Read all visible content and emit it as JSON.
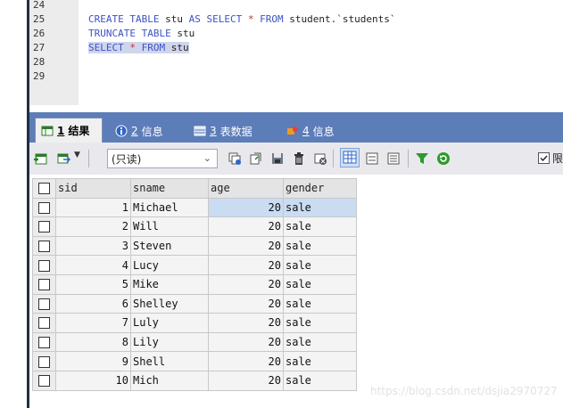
{
  "editor": {
    "lines": [
      {
        "num": "24",
        "code": ""
      },
      {
        "num": "25",
        "code": "CREATE TABLE stu AS SELECT * FROM student.`students`"
      },
      {
        "num": "26",
        "code": "TRUNCATE TABLE stu"
      },
      {
        "num": "27",
        "code": "SELECT * FROM stu"
      },
      {
        "num": "28",
        "code": ""
      },
      {
        "num": "29",
        "code": ""
      }
    ]
  },
  "tabs": [
    {
      "num": "1",
      "label": "结果",
      "icon": "grid-result-icon"
    },
    {
      "num": "2",
      "label": "信息",
      "icon": "info-icon"
    },
    {
      "num": "3",
      "label": "表数据",
      "icon": "table-data-icon"
    },
    {
      "num": "4",
      "label": "信息",
      "icon": "message-icon"
    }
  ],
  "toolbar": {
    "readonly_select": "(只读)",
    "limit_label": "限制行",
    "limit_checked": true,
    "icons": [
      "add-row-icon",
      "export-icon",
      "save-icon",
      "copy-icon",
      "disk-save-icon",
      "delete-icon",
      "discard-icon",
      "grid-view-icon",
      "form-view-icon",
      "text-view-icon",
      "filter-icon",
      "refresh-icon"
    ]
  },
  "results": {
    "columns": [
      "sid",
      "sname",
      "age",
      "gender"
    ],
    "rows": [
      [
        "1",
        "Michael",
        "20",
        "sale"
      ],
      [
        "2",
        "Will",
        "20",
        "sale"
      ],
      [
        "3",
        "Steven",
        "20",
        "sale"
      ],
      [
        "4",
        "Lucy",
        "20",
        "sale"
      ],
      [
        "5",
        "Mike",
        "20",
        "sale"
      ],
      [
        "6",
        "Shelley",
        "20",
        "sale"
      ],
      [
        "7",
        "Luly",
        "20",
        "sale"
      ],
      [
        "8",
        "Lily",
        "20",
        "sale"
      ],
      [
        "9",
        "Shell",
        "20",
        "sale"
      ],
      [
        "10",
        "Mich",
        "20",
        "sale"
      ]
    ]
  },
  "watermark": "https://blog.csdn.net/dsjia2970727",
  "colors": {
    "tab_bar": "#5d7db8",
    "keyword": "#3c52c5",
    "selection": "#c9dcf2"
  }
}
